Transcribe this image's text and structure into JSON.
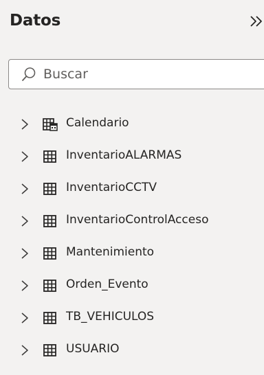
{
  "panel": {
    "title": "Datos",
    "collapse_icon": "double-chevron-right-icon"
  },
  "search": {
    "placeholder": "Buscar",
    "value": "",
    "icon": "search-icon"
  },
  "tables": [
    {
      "label": "Calendario",
      "icon": "calendar-table-icon",
      "expanded": false
    },
    {
      "label": "InventarioALARMAS",
      "icon": "table-icon",
      "expanded": false
    },
    {
      "label": "InventarioCCTV",
      "icon": "table-icon",
      "expanded": false
    },
    {
      "label": "InventarioControlAcceso",
      "icon": "table-icon",
      "expanded": false
    },
    {
      "label": "Mantenimiento",
      "icon": "table-icon",
      "expanded": false
    },
    {
      "label": "Orden_Evento",
      "icon": "table-icon",
      "expanded": false
    },
    {
      "label": "TB_VEHICULOS",
      "icon": "table-icon",
      "expanded": false
    },
    {
      "label": "USUARIO",
      "icon": "table-icon",
      "expanded": false
    }
  ],
  "colors": {
    "background": "#f3f2f1",
    "text": "#252423",
    "border": "#8a8886"
  }
}
